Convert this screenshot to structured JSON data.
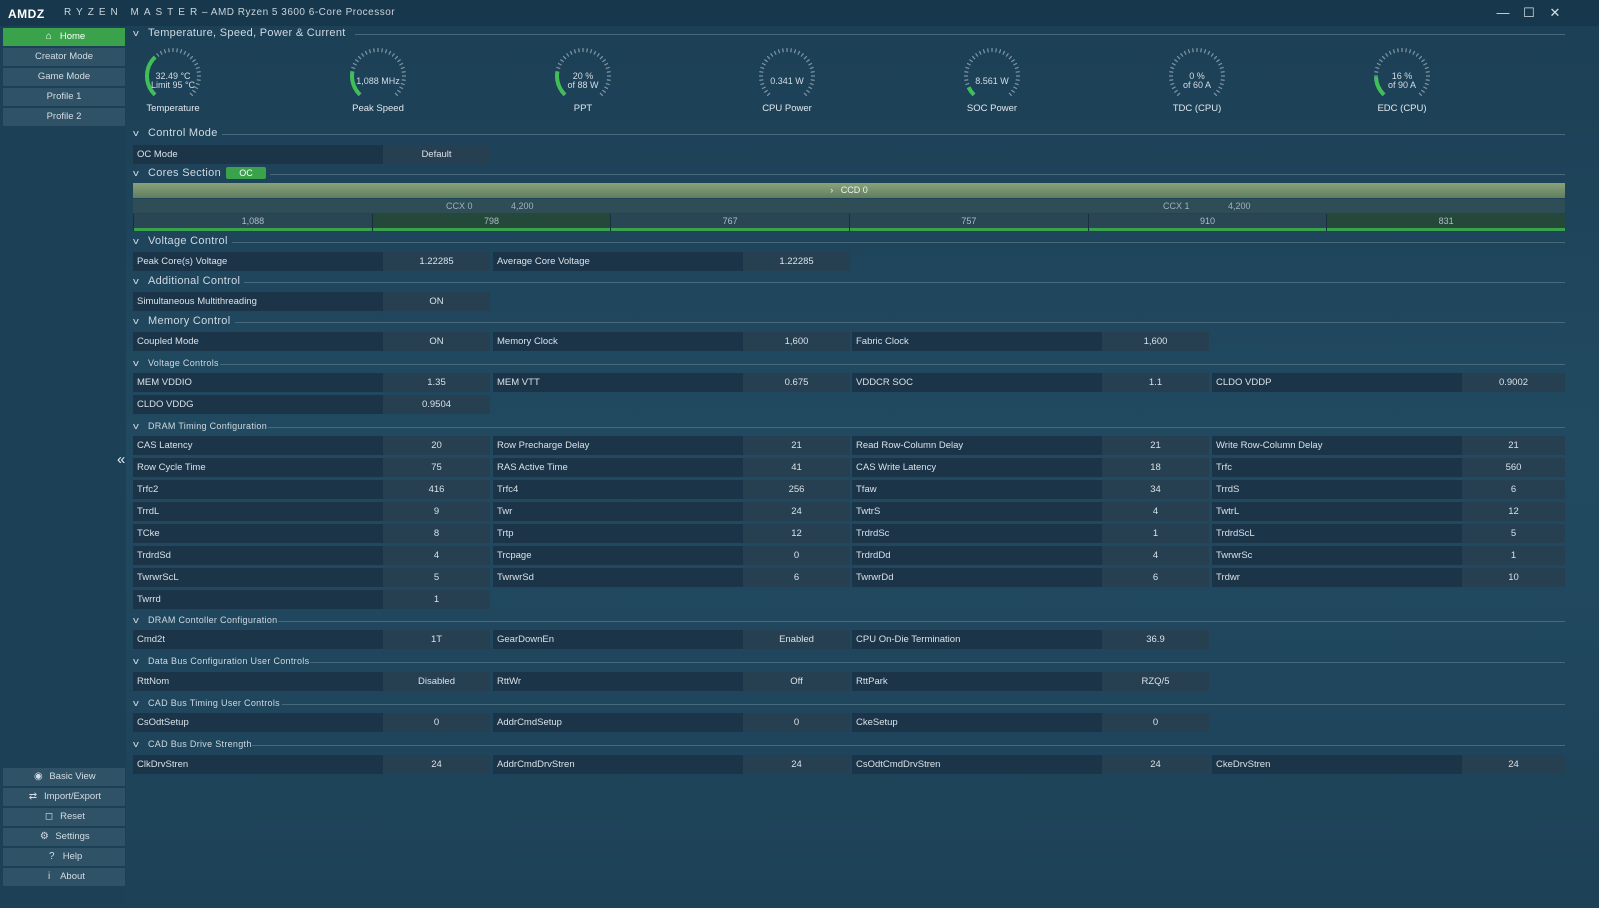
{
  "titlebar": {
    "logo": "AMDZ",
    "app": "RYZEN MASTER",
    "processor": "–  AMD Ryzen 5 3600 6-Core Processor",
    "minimize": "—",
    "maximize": "☐",
    "close": "✕"
  },
  "sidebar": {
    "items": [
      {
        "label": "Home",
        "icon": "home-icon"
      },
      {
        "label": "Creator Mode"
      },
      {
        "label": "Game Mode"
      },
      {
        "label": "Profile 1"
      },
      {
        "label": "Profile 2"
      }
    ],
    "bottom": [
      {
        "label": "Basic View",
        "icon": "eye-icon"
      },
      {
        "label": "Import/Export",
        "icon": "import-export-icon"
      },
      {
        "label": "Reset",
        "icon": "reset-icon"
      },
      {
        "label": "Settings",
        "icon": "wrench-icon"
      },
      {
        "label": "Help",
        "icon": "help-icon"
      },
      {
        "label": "About",
        "icon": "info-icon"
      }
    ],
    "collapse": "«"
  },
  "sections": {
    "temp": "Temperature, Speed, Power & Current",
    "control": "Control Mode",
    "cores": "Cores Section",
    "voltage": "Voltage Control",
    "additional": "Additional Control",
    "memory": "Memory Control",
    "voltage_controls": "Voltage Controls",
    "dram_timing": "DRAM Timing Configuration",
    "dram_controller": "DRAM Contoller Configuration",
    "data_bus": "Data Bus Configuration User Controls",
    "cad_timing": "CAD Bus Timing User Controls",
    "cad_drive": "CAD Bus Drive Strength"
  },
  "gauges": [
    {
      "l1": "32.49 °C",
      "l2": "Limit 95 °C",
      "name": "Temperature",
      "fill": 0.34
    },
    {
      "l1": "1,088  MHz",
      "l2": "",
      "name": "Peak Speed",
      "fill": 0.2
    },
    {
      "l1": "20 %",
      "l2": "of 88 W",
      "name": "PPT",
      "fill": 0.2
    },
    {
      "l1": "0.341  W",
      "l2": "",
      "name": "CPU Power",
      "fill": 0.0
    },
    {
      "l1": "8.561  W",
      "l2": "",
      "name": "SOC Power",
      "fill": 0.07
    },
    {
      "l1": "0 %",
      "l2": "of 60 A",
      "name": "TDC (CPU)",
      "fill": 0.0
    },
    {
      "l1": "16 %",
      "l2": "of 90 A",
      "name": "EDC (CPU)",
      "fill": 0.16
    }
  ],
  "control_mode": {
    "label": "OC Mode",
    "value": "Default"
  },
  "cores": {
    "pill": "OC",
    "ccd": "CCD 0",
    "ccd_chevron": "›",
    "ccx0": "CCX 0",
    "ccx0_freq": "4,200",
    "ccx1": "CCX 1",
    "ccx1_freq": "4,200",
    "values": [
      "1,088",
      "798",
      "767",
      "757",
      "910",
      "831"
    ]
  },
  "voltage": [
    {
      "label": "Peak Core(s) Voltage",
      "value": "1.22285"
    },
    {
      "label": "Average Core Voltage",
      "value": "1.22285"
    }
  ],
  "additional": [
    {
      "label": "Simultaneous Multithreading",
      "value": "ON"
    }
  ],
  "memory": [
    {
      "label": "Coupled Mode",
      "value": "ON"
    },
    {
      "label": "Memory Clock",
      "value": "1,600"
    },
    {
      "label": "Fabric Clock",
      "value": "1,600"
    }
  ],
  "voltage_controls": [
    {
      "label": "MEM VDDIO",
      "value": "1.35"
    },
    {
      "label": "MEM VTT",
      "value": "0.675"
    },
    {
      "label": "VDDCR SOC",
      "value": "1.1"
    },
    {
      "label": "CLDO VDDP",
      "value": "0.9002"
    },
    {
      "label": "CLDO VDDG",
      "value": "0.9504"
    }
  ],
  "dram_timing": [
    {
      "label": "CAS Latency",
      "value": "20"
    },
    {
      "label": "Row Precharge Delay",
      "value": "21"
    },
    {
      "label": "Read Row-Column Delay",
      "value": "21"
    },
    {
      "label": "Write Row-Column Delay",
      "value": "21"
    },
    {
      "label": "Row Cycle Time",
      "value": "75"
    },
    {
      "label": "RAS Active Time",
      "value": "41"
    },
    {
      "label": "CAS Write Latency",
      "value": "18"
    },
    {
      "label": "Trfc",
      "value": "560"
    },
    {
      "label": "Trfc2",
      "value": "416"
    },
    {
      "label": "Trfc4",
      "value": "256"
    },
    {
      "label": "Tfaw",
      "value": "34"
    },
    {
      "label": "TrrdS",
      "value": "6"
    },
    {
      "label": "TrrdL",
      "value": "9"
    },
    {
      "label": "Twr",
      "value": "24"
    },
    {
      "label": "TwtrS",
      "value": "4"
    },
    {
      "label": "TwtrL",
      "value": "12"
    },
    {
      "label": "TCke",
      "value": "8"
    },
    {
      "label": "Trtp",
      "value": "12"
    },
    {
      "label": "TrdrdSc",
      "value": "1"
    },
    {
      "label": "TrdrdScL",
      "value": "5"
    },
    {
      "label": "TrdrdSd",
      "value": "4"
    },
    {
      "label": "Trcpage",
      "value": "0"
    },
    {
      "label": "TrdrdDd",
      "value": "4"
    },
    {
      "label": "TwrwrSc",
      "value": "1"
    },
    {
      "label": "TwrwrScL",
      "value": "5"
    },
    {
      "label": "TwrwrSd",
      "value": "6"
    },
    {
      "label": "TwrwrDd",
      "value": "6"
    },
    {
      "label": "Trdwr",
      "value": "10"
    },
    {
      "label": "Twrrd",
      "value": "1"
    }
  ],
  "dram_controller": [
    {
      "label": "Cmd2t",
      "value": "1T"
    },
    {
      "label": "GearDownEn",
      "value": "Enabled"
    },
    {
      "label": "CPU On-Die Termination",
      "value": "36.9"
    }
  ],
  "data_bus": [
    {
      "label": "RttNom",
      "value": "Disabled"
    },
    {
      "label": "RttWr",
      "value": "Off"
    },
    {
      "label": "RttPark",
      "value": "RZQ/5"
    }
  ],
  "cad_timing": [
    {
      "label": "CsOdtSetup",
      "value": "0"
    },
    {
      "label": "AddrCmdSetup",
      "value": "0"
    },
    {
      "label": "CkeSetup",
      "value": "0"
    }
  ],
  "cad_drive": [
    {
      "label": "ClkDrvStren",
      "value": "24"
    },
    {
      "label": "AddrCmdDrvStren",
      "value": "24"
    },
    {
      "label": "CsOdtCmdDrvStren",
      "value": "24"
    },
    {
      "label": "CkeDrvStren",
      "value": "24"
    }
  ],
  "colors": {
    "accent": "#3aa24a",
    "background": "#1f4459",
    "field": "#1b3448"
  }
}
